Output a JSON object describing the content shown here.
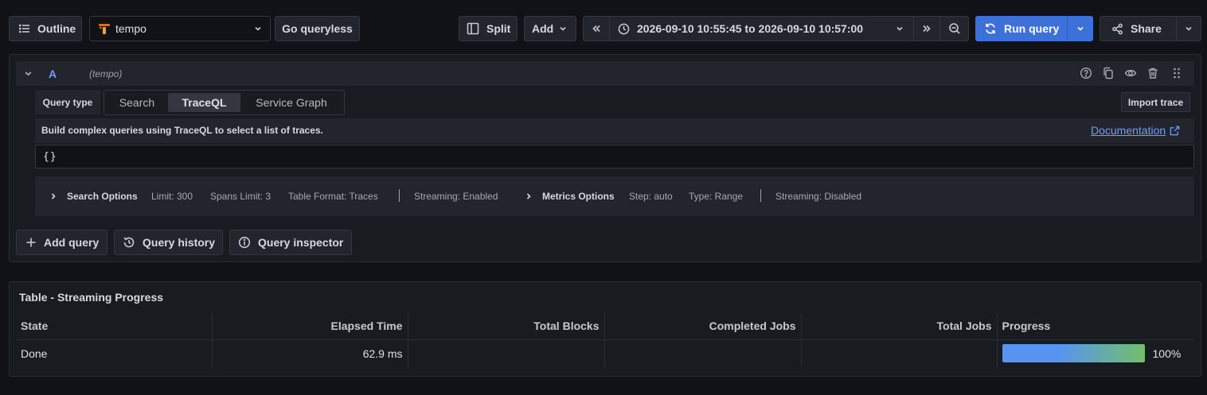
{
  "toolbar": {
    "outline_label": "Outline",
    "datasource_name": "tempo",
    "go_queryless_label": "Go queryless",
    "split_label": "Split",
    "add_label": "Add",
    "time_range": "2026-09-10 10:55:45 to 2026-09-10 10:57:00",
    "run_query_label": "Run query",
    "share_label": "Share"
  },
  "query": {
    "ref_id": "A",
    "datasource_hint": "(tempo)",
    "query_type_label": "Query type",
    "query_types": [
      "Search",
      "TraceQL",
      "Service Graph"
    ],
    "selected_query_type": "TraceQL",
    "import_trace_label": "Import trace",
    "help_text": "Build complex queries using TraceQL to select a list of traces.",
    "documentation_label": "Documentation",
    "editor_value": "{}",
    "search_options": {
      "label": "Search Options",
      "limit": "Limit: 300",
      "spans_limit": "Spans Limit: 3",
      "table_format": "Table Format: Traces",
      "streaming": "Streaming: Enabled"
    },
    "metrics_options": {
      "label": "Metrics Options",
      "step": "Step: auto",
      "type": "Type: Range",
      "streaming": "Streaming: Disabled"
    }
  },
  "actions": {
    "add_query_label": "Add query",
    "query_history_label": "Query history",
    "query_inspector_label": "Query inspector"
  },
  "table": {
    "title": "Table - Streaming Progress",
    "columns": [
      "State",
      "Elapsed Time",
      "Total Blocks",
      "Completed Jobs",
      "Total Jobs",
      "Progress"
    ],
    "rows": [
      {
        "state": "Done",
        "elapsed_time": "62.9 ms",
        "total_blocks": "",
        "completed_jobs": "",
        "total_jobs": "",
        "progress_label": "100%",
        "progress_fraction": 1.0
      }
    ]
  },
  "colors": {
    "primary": "#3d71d9",
    "progress_start": "#5794f2",
    "progress_end": "#73bf69",
    "link": "#6e9fff",
    "ref_id": "#6e9fff"
  }
}
